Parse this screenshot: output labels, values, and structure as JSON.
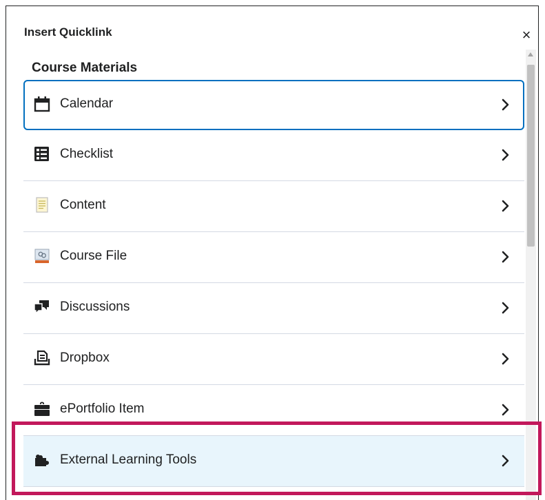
{
  "dialog": {
    "title": "Insert Quicklink",
    "close_glyph": "×"
  },
  "section": {
    "title": "Course Materials"
  },
  "items": [
    {
      "label": "Calendar",
      "icon": "calendar-icon",
      "state": "focused"
    },
    {
      "label": "Checklist",
      "icon": "checklist-icon",
      "state": "normal"
    },
    {
      "label": "Content",
      "icon": "content-icon",
      "state": "normal"
    },
    {
      "label": "Course File",
      "icon": "course-file-icon",
      "state": "normal"
    },
    {
      "label": "Discussions",
      "icon": "discussions-icon",
      "state": "normal"
    },
    {
      "label": "Dropbox",
      "icon": "dropbox-icon",
      "state": "normal"
    },
    {
      "label": "ePortfolio Item",
      "icon": "eportfolio-icon",
      "state": "normal"
    },
    {
      "label": "External Learning Tools",
      "icon": "puzzle-icon",
      "state": "highlighted"
    }
  ],
  "colors": {
    "focus_border": "#006fbf",
    "highlight_bg": "#e8f5fc",
    "annotation": "#c2185b",
    "divider": "#d3d9e3"
  }
}
